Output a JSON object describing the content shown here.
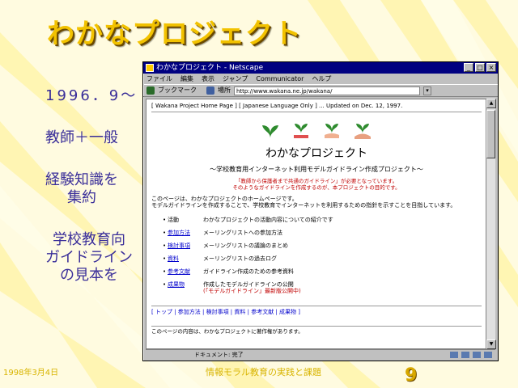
{
  "slide": {
    "title": "わかなプロジェクト",
    "bullets": [
      "1996．9～",
      "教師＋一般",
      "経験知識を\n集約",
      "学校教育向\nガイドライン\nの見本を"
    ],
    "footer_date": "1998年3月4日",
    "footer_center": "情報モラル教育の実践と課題",
    "page_number": "9"
  },
  "browser": {
    "window_title": "わかなプロジェクト - Netscape",
    "menu": [
      "ファイル",
      "編集",
      "表示",
      "ジャンプ",
      "Communicator",
      "ヘルプ"
    ],
    "toolbar_label": "ブックマーク",
    "location_label": "場所",
    "url": "http://www.wakana.ne.jp/wakana/",
    "status_text": "ドキュメント: 完了",
    "page": {
      "header": "[ Wakana Project Home Page ] [ Japanese Language Only ] ... Updated on Dec. 12, 1997.",
      "title": "わかなプロジェクト",
      "subtitle": "～学校教育用インターネット利用モデルガイドライン作成プロジェクト～",
      "red_notice": "「教師から保護者まで共通のガイドライン」が必要となっています。\nそのようなガイドラインを作成するのが、本プロジェクトの目的です。",
      "intro": "このページは、わかなプロジェクトのホームページです。\nモデルガイドラインを作成することで、学校教育でインターネットを利用するための指針を示すことを目指しています。",
      "items": [
        {
          "label": "活動",
          "desc": "わかなプロジェクトの活動内容についての紹介です",
          "red": "",
          "link": false
        },
        {
          "label": "参加方法",
          "desc": "メーリングリストへの参加方法",
          "red": "",
          "link": true
        },
        {
          "label": "検討事項",
          "desc": "メーリングリストの議論のまとめ",
          "red": "",
          "link": true
        },
        {
          "label": "資料",
          "desc": "メーリングリストの過去ログ",
          "red": "",
          "link": true
        },
        {
          "label": "参考文献",
          "desc": "ガイドライン作成のための参考資料",
          "red": "",
          "link": true
        },
        {
          "label": "成果物",
          "desc": "作成したモデルガイドラインの公開",
          "red": "(「モデルガイドライン」最新版公開中)",
          "link": true
        }
      ],
      "links_row": "[ トップ | 参加方法 | 検討事項 | 資料 | 参考文献 | 成果物 ]",
      "footer": "このページの内容は、わかなプロジェクトに著作権があります。"
    }
  }
}
